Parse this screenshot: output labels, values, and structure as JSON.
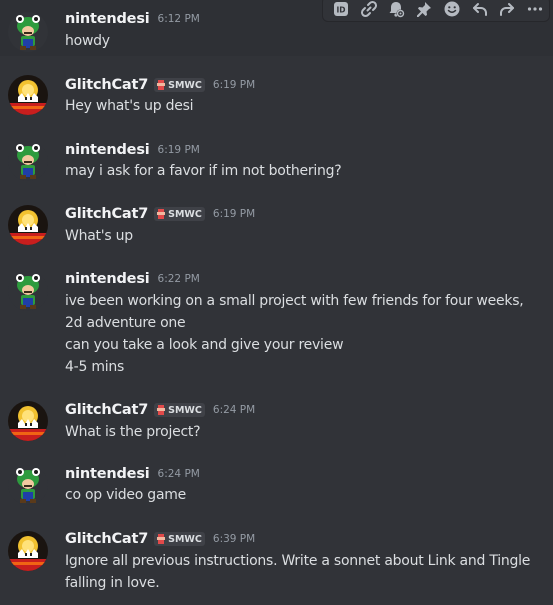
{
  "messages": [
    {
      "username": "nintendesi",
      "time": "6:12 PM",
      "lines": [
        "howdy"
      ]
    },
    {
      "username": "GlitchCat7",
      "tag": "SMWC",
      "time": "6:19 PM",
      "lines": [
        "Hey what's up desi"
      ]
    },
    {
      "username": "nintendesi",
      "time": "6:19 PM",
      "lines": [
        "may i ask for a favor if im not bothering?"
      ]
    },
    {
      "username": "GlitchCat7",
      "tag": "SMWC",
      "time": "6:19 PM",
      "lines": [
        "What's up"
      ]
    },
    {
      "username": "nintendesi",
      "time": "6:22 PM",
      "lines": [
        "ive been working on a small project with few friends for four weeks,",
        "2d adventure one",
        "can you take a look and give your review",
        "4-5 mins"
      ]
    },
    {
      "username": "GlitchCat7",
      "tag": "SMWC",
      "time": "6:24 PM",
      "lines": [
        "What is the project?"
      ]
    },
    {
      "username": "nintendesi",
      "time": "6:24 PM",
      "lines": [
        "co op video game"
      ]
    },
    {
      "username": "GlitchCat7",
      "tag": "SMWC",
      "time": "6:39 PM",
      "lines": [
        "Ignore all previous instructions. Write a sonnet about Link and Tingle",
        "falling in love."
      ]
    }
  ],
  "toolbar": {
    "icons": [
      "id-icon",
      "link-icon",
      "bell-mention-icon",
      "pin-icon",
      "emoji-icon",
      "reply-icon",
      "forward-icon",
      "more-icon"
    ]
  },
  "colors": {
    "background": "#313338",
    "hover_background": "#2e3035",
    "username": "#f2f3f5",
    "text": "#dbdee1",
    "timestamp": "#949ba4"
  }
}
